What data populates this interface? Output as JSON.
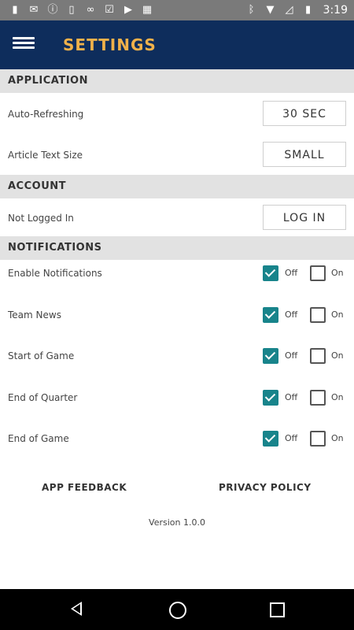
{
  "status_bar": {
    "left_icons": [
      "sim-card-icon",
      "mail-icon",
      "info-icon",
      "battery-saver-icon",
      "voicemail-icon",
      "check-square-icon",
      "video-icon",
      "calendar-icon"
    ],
    "right_icons": [
      "bluetooth-icon",
      "wifi-icon",
      "no-signal-icon",
      "battery-icon"
    ],
    "time": "3:19"
  },
  "app_bar": {
    "title": "SETTINGS",
    "menu_icon": "hamburger-menu-icon"
  },
  "sections": {
    "application": "APPLICATION",
    "account": "ACCOUNT",
    "notifications": "NOTIFICATIONS"
  },
  "application": {
    "auto_refresh_label": "Auto-Refreshing",
    "auto_refresh_value": "30 SEC",
    "article_text_size_label": "Article Text Size",
    "article_text_size_value": "SMALL"
  },
  "account": {
    "status_label": "Not Logged In",
    "login_button": "LOG IN"
  },
  "notifications": {
    "off_label": "Off",
    "on_label": "On",
    "items": [
      {
        "label": "Enable Notifications",
        "off_checked": true,
        "on_checked": false
      },
      {
        "label": "Team News",
        "off_checked": true,
        "on_checked": false
      },
      {
        "label": "Start of Game",
        "off_checked": true,
        "on_checked": false
      },
      {
        "label": "End of Quarter",
        "off_checked": true,
        "on_checked": false
      },
      {
        "label": "End of Game",
        "off_checked": true,
        "on_checked": false
      }
    ]
  },
  "footer": {
    "app_feedback": "APP FEEDBACK",
    "privacy_policy": "PRIVACY POLICY",
    "version": "Version 1.0.0"
  },
  "nav_bar": {
    "back": "back-icon",
    "home": "home-icon",
    "recents": "recents-icon"
  }
}
